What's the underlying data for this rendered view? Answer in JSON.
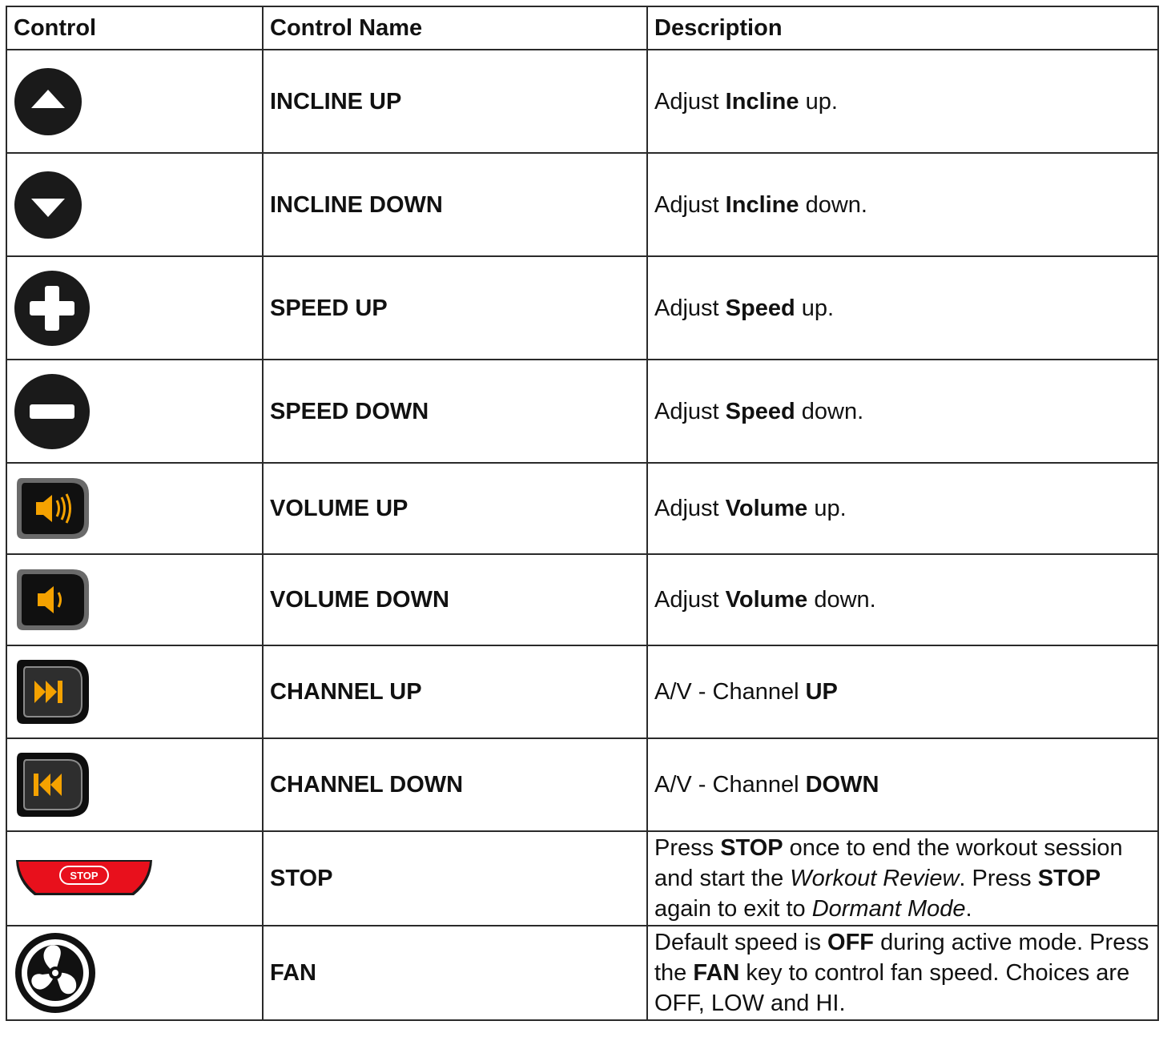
{
  "headers": {
    "control": "Control",
    "control_name": "Control Name",
    "description": "Description"
  },
  "colors": {
    "button_dark": "#1a1a1a",
    "icon_amber": "#f5a200",
    "stop_red": "#e8101c",
    "border": "#2a2a2a"
  },
  "rows": [
    {
      "icon": "incline-up-icon",
      "name": "INCLINE UP",
      "desc": {
        "pre": "Adjust ",
        "bold": "Incline",
        "post": " up."
      }
    },
    {
      "icon": "incline-down-icon",
      "name": "INCLINE DOWN",
      "desc": {
        "pre": "Adjust ",
        "bold": "Incline",
        "post": " down."
      }
    },
    {
      "icon": "speed-up-plus-icon",
      "name": "SPEED UP",
      "desc": {
        "pre": "Adjust ",
        "bold": "Speed",
        "post": " up."
      }
    },
    {
      "icon": "speed-down-minus-icon",
      "name": "SPEED DOWN",
      "desc": {
        "pre": "Adjust ",
        "bold": "Speed",
        "post": " down."
      }
    },
    {
      "icon": "volume-up-icon",
      "name": "VOLUME UP",
      "desc": {
        "pre": "Adjust ",
        "bold": "Volume",
        "post": " up."
      }
    },
    {
      "icon": "volume-down-icon",
      "name": "VOLUME DOWN",
      "desc": {
        "pre": "Adjust ",
        "bold": "Volume",
        "post": " down."
      }
    },
    {
      "icon": "channel-up-skip-forward-icon",
      "name": "CHANNEL UP",
      "desc": {
        "pre": "A/V - Channel ",
        "bold": "UP",
        "post": ""
      }
    },
    {
      "icon": "channel-down-skip-back-icon",
      "name": "CHANNEL DOWN",
      "desc": {
        "pre": "A/V - Channel ",
        "bold": "DOWN",
        "post": ""
      }
    },
    {
      "icon": "stop-button-icon",
      "icon_label": "STOP",
      "name": "STOP",
      "desc": {
        "p1": "Press ",
        "b1": "STOP",
        "p2": " once to end the workout session and start the ",
        "i1": "Workout Review",
        "p3": ". Press ",
        "b2": "STOP",
        "p4": " again to exit to ",
        "i2": "Dormant Mode",
        "p5": "."
      }
    },
    {
      "icon": "fan-icon",
      "name": "FAN",
      "desc": {
        "p1": "Default speed is ",
        "b1": "OFF",
        "p2": " during active mode. Press the ",
        "b2": "FAN",
        "p3": " key to control fan speed. Choices are OFF, LOW and HI."
      }
    }
  ]
}
